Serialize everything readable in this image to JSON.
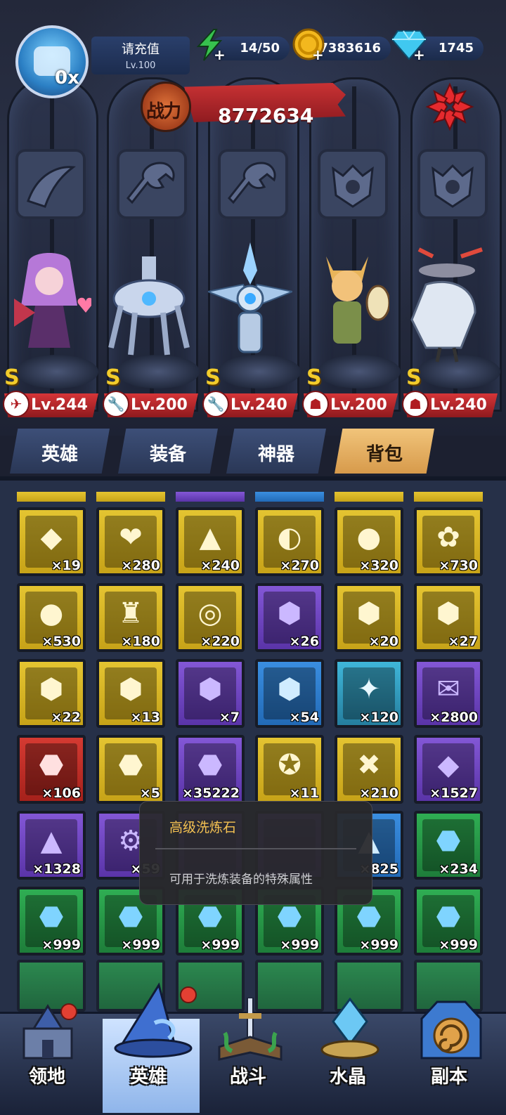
{
  "header": {
    "avatar_text": "0x",
    "player_name": "请充值",
    "player_level": "Lv.100",
    "stamina": "14/50",
    "gold": "7383616",
    "diamonds": "1745"
  },
  "combat_power": {
    "label": "战力",
    "value": "8772634"
  },
  "heroes": [
    {
      "level": "Lv.244",
      "rank": "S",
      "type_icon": "wing-icon"
    },
    {
      "level": "Lv.200",
      "rank": "S",
      "type_icon": "wrench-icon"
    },
    {
      "level": "Lv.240",
      "rank": "S",
      "type_icon": "wrench-icon"
    },
    {
      "level": "Lv.200",
      "rank": "S",
      "type_icon": "beast-icon"
    },
    {
      "level": "Lv.240",
      "rank": "S",
      "type_icon": "beast-icon"
    }
  ],
  "tabs": [
    {
      "label": "英雄",
      "active": false
    },
    {
      "label": "装备",
      "active": false
    },
    {
      "label": "神器",
      "active": false
    },
    {
      "label": "背包",
      "active": true
    }
  ],
  "inventory": [
    {
      "count": "×19",
      "quality": "gold",
      "icon": "crystal-shard-icon"
    },
    {
      "count": "×280",
      "quality": "gold",
      "icon": "heart-chest-icon"
    },
    {
      "count": "×240",
      "quality": "gold",
      "icon": "blue-hat-icon"
    },
    {
      "count": "×270",
      "quality": "gold",
      "icon": "satellite-dish-icon"
    },
    {
      "count": "×320",
      "quality": "gold",
      "icon": "gourd-icon"
    },
    {
      "count": "×730",
      "quality": "gold",
      "icon": "sprout-icon"
    },
    {
      "count": "×530",
      "quality": "gold",
      "icon": "peach-icon"
    },
    {
      "count": "×180",
      "quality": "gold",
      "icon": "bell-tower-icon"
    },
    {
      "count": "×220",
      "quality": "gold",
      "icon": "planet-ring-icon"
    },
    {
      "count": "×26",
      "quality": "purple",
      "icon": "wing-hexagon-icon"
    },
    {
      "count": "×20",
      "quality": "gold",
      "icon": "beast-hexagon-icon"
    },
    {
      "count": "×27",
      "quality": "gold",
      "icon": "dragon-hexagon-icon"
    },
    {
      "count": "×22",
      "quality": "gold",
      "icon": "bird-hexagon-icon"
    },
    {
      "count": "×13",
      "quality": "gold",
      "icon": "fire-beast-hexagon-icon"
    },
    {
      "count": "×7",
      "quality": "purple",
      "icon": "crystal-hexagon-icon"
    },
    {
      "count": "×54",
      "quality": "blue",
      "icon": "gem-hexagon-icon"
    },
    {
      "count": "×120",
      "quality": "teal",
      "icon": "lightning-crystal-icon"
    },
    {
      "count": "×2800",
      "quality": "purple",
      "icon": "scroll-icon"
    },
    {
      "count": "×106",
      "quality": "red",
      "icon": "rainbow-stone-icon"
    },
    {
      "count": "×5",
      "quality": "gold",
      "icon": "red-stone-icon"
    },
    {
      "count": "×35222",
      "quality": "purple",
      "icon": "blue-stone-icon"
    },
    {
      "count": "×11",
      "quality": "gold",
      "icon": "amulet-icon"
    },
    {
      "count": "×210",
      "quality": "gold",
      "icon": "red-orb-icon"
    },
    {
      "count": "×1527",
      "quality": "purple",
      "icon": "green-gem-icon"
    },
    {
      "count": "×1328",
      "quality": "purple",
      "icon": "prism-icon"
    },
    {
      "count": "×59",
      "quality": "purple",
      "icon": "gear-icon"
    },
    {
      "count": "",
      "quality": "purple",
      "icon": "hidden-item-icon"
    },
    {
      "count": "",
      "quality": "purple",
      "icon": "hidden-item-icon"
    },
    {
      "count": "×825",
      "quality": "blue",
      "icon": "ice-shard-icon"
    },
    {
      "count": "×234",
      "quality": "green",
      "icon": "green-rune-stone-icon"
    },
    {
      "count": "×999",
      "quality": "green",
      "icon": "blue-rune-stone-icon"
    },
    {
      "count": "×999",
      "quality": "green",
      "icon": "blue-rune-stone-icon"
    },
    {
      "count": "×999",
      "quality": "green",
      "icon": "blue-rune-stone-icon"
    },
    {
      "count": "×999",
      "quality": "green",
      "icon": "blue-rune-stone-icon"
    },
    {
      "count": "×999",
      "quality": "green",
      "icon": "blue-rune-stone-icon"
    },
    {
      "count": "×999",
      "quality": "green",
      "icon": "blue-rune-stone-icon"
    }
  ],
  "tooltip": {
    "title": "高级洗炼石",
    "description": "可用于洗炼装备的特殊属性"
  },
  "nav": [
    {
      "label": "领地",
      "icon": "castle-icon",
      "active": false
    },
    {
      "label": "英雄",
      "icon": "wizard-hat-icon",
      "active": true
    },
    {
      "label": "战斗",
      "icon": "sword-book-icon",
      "active": false
    },
    {
      "label": "水晶",
      "icon": "crystal-icon",
      "active": false
    },
    {
      "label": "副本",
      "icon": "portal-icon",
      "active": false
    }
  ],
  "colors": {
    "gold_quality": "#e4c431",
    "purple_quality": "#8357d6",
    "blue_quality": "#3a8ee0",
    "red_quality": "#d53a32",
    "green_quality": "#2fae53",
    "combat_red": "#c93234",
    "active_tab": "#f1c47a"
  }
}
